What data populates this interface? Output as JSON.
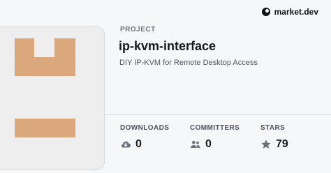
{
  "brand": {
    "name": "market.dev",
    "icon": "market-dev-logo-icon"
  },
  "project": {
    "kicker": "PROJECT",
    "title": "ip-kvm-interface",
    "description": "DIY IP-KVM for Remote Desktop Access"
  },
  "stats": [
    {
      "label": "DOWNLOADS",
      "value": "0",
      "icon": "cloud-download-icon"
    },
    {
      "label": "COMMITTERS",
      "value": "0",
      "icon": "users-icon"
    },
    {
      "label": "STARS",
      "value": "79",
      "icon": "star-icon"
    }
  ],
  "colors": {
    "box": "#dba87e",
    "card": "#eeeeef",
    "background": "#f6f7f9",
    "icon": "#6a7280"
  }
}
